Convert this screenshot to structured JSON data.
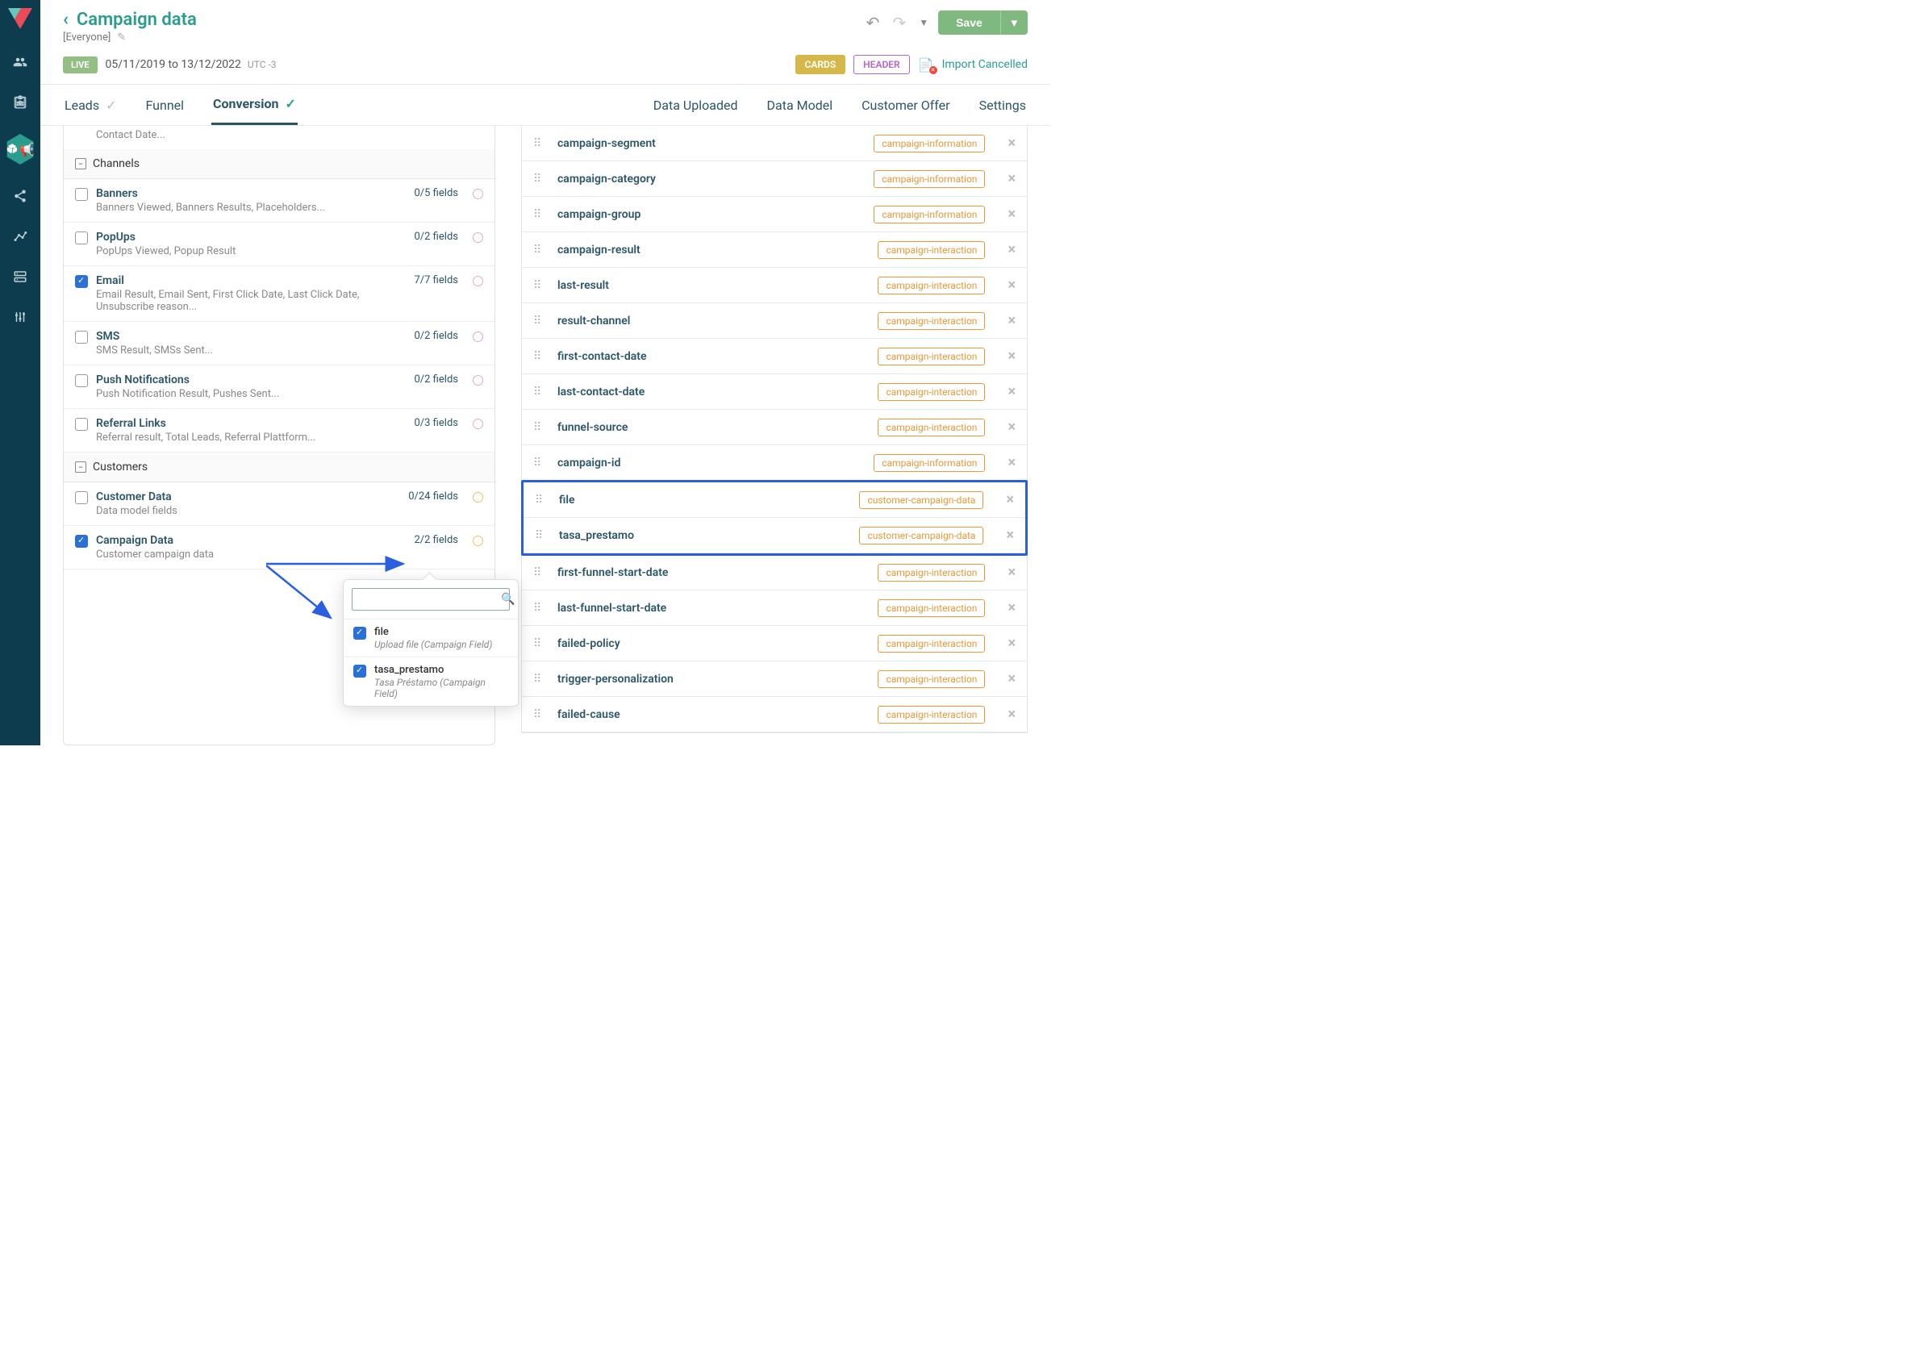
{
  "header": {
    "title": "Campaign data",
    "subtitle": "[Everyone]",
    "live_badge": "LIVE",
    "date_range": "05/11/2019 to 13/12/2022",
    "timezone": "UTC -3",
    "save": "Save",
    "cards_badge": "CARDS",
    "header_badge": "HEADER",
    "import_status": "Import Cancelled"
  },
  "tabs_left": [
    {
      "label": "Leads",
      "active": false,
      "check": false
    },
    {
      "label": "Funnel",
      "active": false,
      "check": null
    },
    {
      "label": "Conversion",
      "active": true,
      "check": true
    }
  ],
  "tabs_right": [
    "Data Uploaded",
    "Data Model",
    "Customer Offer",
    "Settings"
  ],
  "left": {
    "top_remnant": "Contact Date...",
    "sections": [
      {
        "title": "Channels",
        "items": [
          {
            "title": "Banners",
            "desc": "Banners Viewed, Banners Results, Placeholders...",
            "count": "0/5 fields",
            "checked": false,
            "dot": "pink"
          },
          {
            "title": "PopUps",
            "desc": "PopUps Viewed, Popup Result",
            "count": "0/2 fields",
            "checked": false,
            "dot": "pink"
          },
          {
            "title": "Email",
            "desc": "Email Result, Email Sent, First Click Date, Last Click Date, Unsubscribe reason...",
            "count": "7/7 fields",
            "checked": true,
            "dot": "pink"
          },
          {
            "title": "SMS",
            "desc": "SMS Result, SMSs Sent...",
            "count": "0/2 fields",
            "checked": false,
            "dot": "pink"
          },
          {
            "title": "Push Notifications",
            "desc": "Push Notification Result, Pushes Sent...",
            "count": "0/2 fields",
            "checked": false,
            "dot": "pink"
          },
          {
            "title": "Referral Links",
            "desc": "Referral result, Total Leads, Referral Plattform...",
            "count": "0/3 fields",
            "checked": false,
            "dot": "pink"
          }
        ]
      },
      {
        "title": "Customers",
        "items": [
          {
            "title": "Customer Data",
            "desc": "Data model fields",
            "count": "0/24 fields",
            "checked": false,
            "dot": "orange"
          },
          {
            "title": "Campaign Data",
            "desc": "Customer campaign data",
            "count": "2/2 fields",
            "checked": true,
            "dot": "orange"
          }
        ]
      }
    ]
  },
  "right": {
    "rows": [
      {
        "name": "campaign-segment",
        "tag": "campaign-information"
      },
      {
        "name": "campaign-category",
        "tag": "campaign-information"
      },
      {
        "name": "campaign-group",
        "tag": "campaign-information"
      },
      {
        "name": "campaign-result",
        "tag": "campaign-interaction"
      },
      {
        "name": "last-result",
        "tag": "campaign-interaction"
      },
      {
        "name": "result-channel",
        "tag": "campaign-interaction"
      },
      {
        "name": "first-contact-date",
        "tag": "campaign-interaction"
      },
      {
        "name": "last-contact-date",
        "tag": "campaign-interaction"
      },
      {
        "name": "funnel-source",
        "tag": "campaign-interaction"
      },
      {
        "name": "campaign-id",
        "tag": "campaign-information"
      },
      {
        "name": "file",
        "tag": "customer-campaign-data",
        "hl": true
      },
      {
        "name": "tasa_prestamo",
        "tag": "customer-campaign-data",
        "hl": true
      },
      {
        "name": "first-funnel-start-date",
        "tag": "campaign-interaction"
      },
      {
        "name": "last-funnel-start-date",
        "tag": "campaign-interaction"
      },
      {
        "name": "failed-policy",
        "tag": "campaign-interaction"
      },
      {
        "name": "trigger-personalization",
        "tag": "campaign-interaction"
      },
      {
        "name": "failed-cause",
        "tag": "campaign-interaction"
      }
    ]
  },
  "popover": {
    "search_placeholder": "",
    "items": [
      {
        "title": "file",
        "desc": "Upload file (Campaign Field)",
        "checked": true
      },
      {
        "title": "tasa_prestamo",
        "desc": "Tasa Préstamo (Campaign Field)",
        "checked": true
      }
    ]
  }
}
